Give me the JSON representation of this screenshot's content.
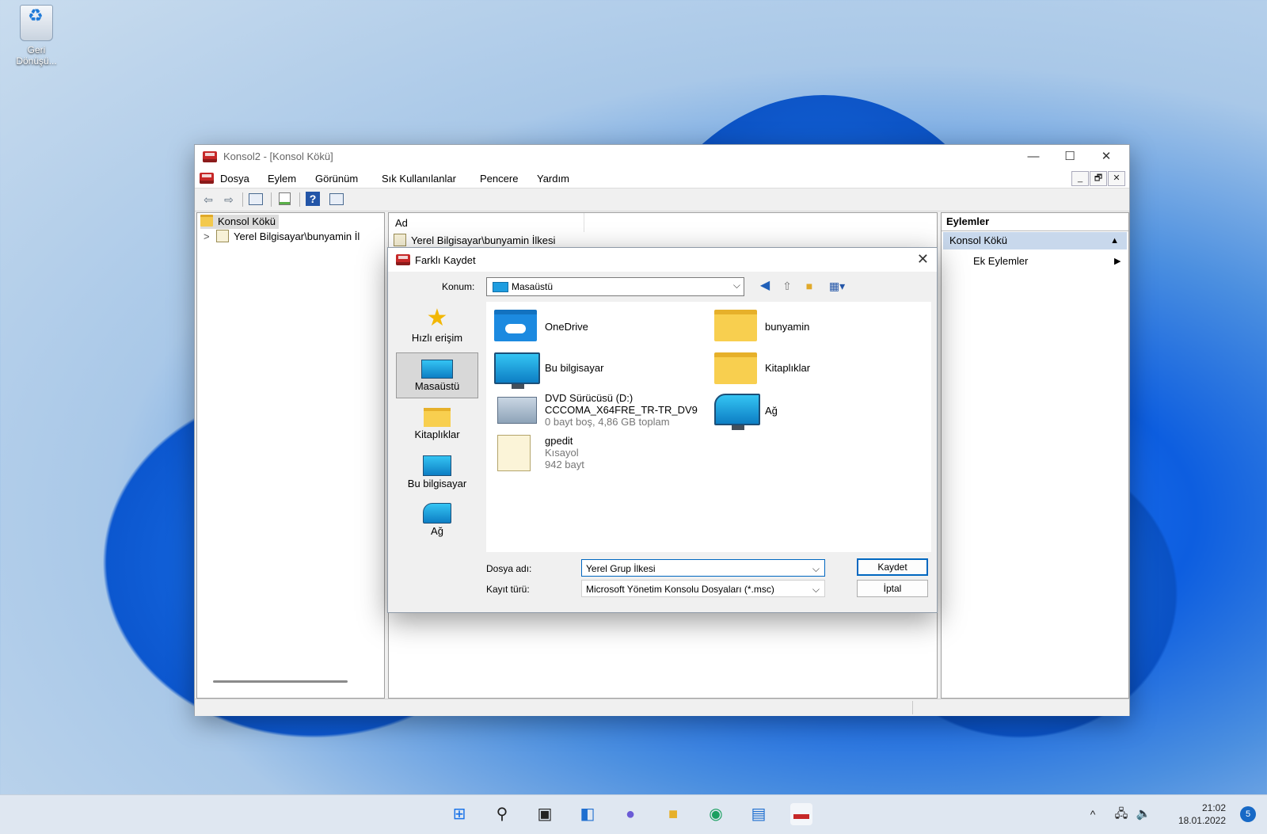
{
  "desktop": {
    "recycle_bin_label": "Geri Dönüşü..."
  },
  "mmc": {
    "title": "Konsol2 - [Konsol Kökü]",
    "window_controls": {
      "minimize": "—",
      "maximize": "☐",
      "close": "✕"
    },
    "menu": [
      "Dosya",
      "Eylem",
      "Görünüm",
      "Sık Kullanılanlar",
      "Pencere",
      "Yardım"
    ],
    "mdi_controls": {
      "minimize": "_",
      "restore": "🗗",
      "close": "✕"
    },
    "toolbar_icons": {
      "back": "⇦",
      "forward": "⇨",
      "help": "?"
    },
    "tree": {
      "root": "Konsol Kökü",
      "child": "Yerel Bilgisayar\\bunyamin İl",
      "expander": ">"
    },
    "center": {
      "column_header": "Ad",
      "row": "Yerel Bilgisayar\\bunyamin İlkesi"
    },
    "actions": {
      "header": "Eylemler",
      "selected": "Konsol Kökü",
      "selected_arrow": "▲",
      "item": "Ek Eylemler",
      "item_arrow": "▶"
    }
  },
  "dialog": {
    "title": "Farklı Kaydet",
    "close": "✕",
    "location_label": "Konum:",
    "location_value": "Masaüstü",
    "dropdown_glyph": "⌵",
    "places": [
      {
        "label": "Hızlı erişim"
      },
      {
        "label": "Masaüstü"
      },
      {
        "label": "Kitaplıklar"
      },
      {
        "label": "Bu bilgisayar"
      },
      {
        "label": "Ağ"
      }
    ],
    "files": {
      "onedrive": {
        "name": "OneDrive"
      },
      "bunyamin": {
        "name": "bunyamin"
      },
      "bu_bilgisayar": {
        "name": "Bu bilgisayar"
      },
      "kitapliklar": {
        "name": "Kitaplıklar"
      },
      "dvd": {
        "name": "DVD Sürücüsü (D:)",
        "line2": "CCCOMA_X64FRE_TR-TR_DV9",
        "line3": "0 bayt boş, 4,86 GB toplam"
      },
      "ag": {
        "name": "Ağ"
      },
      "gpedit": {
        "name": "gpedit",
        "line2": "Kısayol",
        "line3": "942 bayt"
      }
    },
    "filename_label": "Dosya adı:",
    "filename_value": "Yerel Grup İlkesi",
    "filetype_label": "Kayıt türü:",
    "filetype_value": "Microsoft Yönetim Konsolu Dosyaları (*.msc)",
    "save_button": "Kaydet",
    "cancel_button": "İptal"
  },
  "taskbar": {
    "time": "21:02",
    "date": "18.01.2022",
    "notification_count": "5",
    "tray_chevron": "^"
  }
}
